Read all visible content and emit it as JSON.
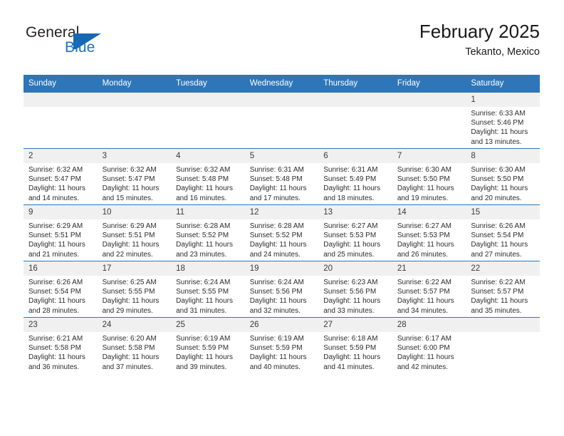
{
  "brand": {
    "name_part1": "General",
    "name_part2": "Blue",
    "logo_icon": "triangle-logo-icon"
  },
  "header": {
    "title": "February 2025",
    "subtitle": "Tekanto, Mexico"
  },
  "calendar": {
    "weekday_headers": [
      "Sunday",
      "Monday",
      "Tuesday",
      "Wednesday",
      "Thursday",
      "Friday",
      "Saturday"
    ],
    "accent_color": "#2e76b8",
    "daynum_bg": "#f0f0f0",
    "weeks": [
      [
        {
          "blank": true
        },
        {
          "blank": true
        },
        {
          "blank": true
        },
        {
          "blank": true
        },
        {
          "blank": true
        },
        {
          "blank": true
        },
        {
          "day": "1",
          "sunrise": "Sunrise: 6:33 AM",
          "sunset": "Sunset: 5:46 PM",
          "daylight_line1": "Daylight: 11 hours",
          "daylight_line2": "and 13 minutes."
        }
      ],
      [
        {
          "day": "2",
          "sunrise": "Sunrise: 6:32 AM",
          "sunset": "Sunset: 5:47 PM",
          "daylight_line1": "Daylight: 11 hours",
          "daylight_line2": "and 14 minutes."
        },
        {
          "day": "3",
          "sunrise": "Sunrise: 6:32 AM",
          "sunset": "Sunset: 5:47 PM",
          "daylight_line1": "Daylight: 11 hours",
          "daylight_line2": "and 15 minutes."
        },
        {
          "day": "4",
          "sunrise": "Sunrise: 6:32 AM",
          "sunset": "Sunset: 5:48 PM",
          "daylight_line1": "Daylight: 11 hours",
          "daylight_line2": "and 16 minutes."
        },
        {
          "day": "5",
          "sunrise": "Sunrise: 6:31 AM",
          "sunset": "Sunset: 5:48 PM",
          "daylight_line1": "Daylight: 11 hours",
          "daylight_line2": "and 17 minutes."
        },
        {
          "day": "6",
          "sunrise": "Sunrise: 6:31 AM",
          "sunset": "Sunset: 5:49 PM",
          "daylight_line1": "Daylight: 11 hours",
          "daylight_line2": "and 18 minutes."
        },
        {
          "day": "7",
          "sunrise": "Sunrise: 6:30 AM",
          "sunset": "Sunset: 5:50 PM",
          "daylight_line1": "Daylight: 11 hours",
          "daylight_line2": "and 19 minutes."
        },
        {
          "day": "8",
          "sunrise": "Sunrise: 6:30 AM",
          "sunset": "Sunset: 5:50 PM",
          "daylight_line1": "Daylight: 11 hours",
          "daylight_line2": "and 20 minutes."
        }
      ],
      [
        {
          "day": "9",
          "sunrise": "Sunrise: 6:29 AM",
          "sunset": "Sunset: 5:51 PM",
          "daylight_line1": "Daylight: 11 hours",
          "daylight_line2": "and 21 minutes."
        },
        {
          "day": "10",
          "sunrise": "Sunrise: 6:29 AM",
          "sunset": "Sunset: 5:51 PM",
          "daylight_line1": "Daylight: 11 hours",
          "daylight_line2": "and 22 minutes."
        },
        {
          "day": "11",
          "sunrise": "Sunrise: 6:28 AM",
          "sunset": "Sunset: 5:52 PM",
          "daylight_line1": "Daylight: 11 hours",
          "daylight_line2": "and 23 minutes."
        },
        {
          "day": "12",
          "sunrise": "Sunrise: 6:28 AM",
          "sunset": "Sunset: 5:52 PM",
          "daylight_line1": "Daylight: 11 hours",
          "daylight_line2": "and 24 minutes."
        },
        {
          "day": "13",
          "sunrise": "Sunrise: 6:27 AM",
          "sunset": "Sunset: 5:53 PM",
          "daylight_line1": "Daylight: 11 hours",
          "daylight_line2": "and 25 minutes."
        },
        {
          "day": "14",
          "sunrise": "Sunrise: 6:27 AM",
          "sunset": "Sunset: 5:53 PM",
          "daylight_line1": "Daylight: 11 hours",
          "daylight_line2": "and 26 minutes."
        },
        {
          "day": "15",
          "sunrise": "Sunrise: 6:26 AM",
          "sunset": "Sunset: 5:54 PM",
          "daylight_line1": "Daylight: 11 hours",
          "daylight_line2": "and 27 minutes."
        }
      ],
      [
        {
          "day": "16",
          "sunrise": "Sunrise: 6:26 AM",
          "sunset": "Sunset: 5:54 PM",
          "daylight_line1": "Daylight: 11 hours",
          "daylight_line2": "and 28 minutes."
        },
        {
          "day": "17",
          "sunrise": "Sunrise: 6:25 AM",
          "sunset": "Sunset: 5:55 PM",
          "daylight_line1": "Daylight: 11 hours",
          "daylight_line2": "and 29 minutes."
        },
        {
          "day": "18",
          "sunrise": "Sunrise: 6:24 AM",
          "sunset": "Sunset: 5:55 PM",
          "daylight_line1": "Daylight: 11 hours",
          "daylight_line2": "and 31 minutes."
        },
        {
          "day": "19",
          "sunrise": "Sunrise: 6:24 AM",
          "sunset": "Sunset: 5:56 PM",
          "daylight_line1": "Daylight: 11 hours",
          "daylight_line2": "and 32 minutes."
        },
        {
          "day": "20",
          "sunrise": "Sunrise: 6:23 AM",
          "sunset": "Sunset: 5:56 PM",
          "daylight_line1": "Daylight: 11 hours",
          "daylight_line2": "and 33 minutes."
        },
        {
          "day": "21",
          "sunrise": "Sunrise: 6:22 AM",
          "sunset": "Sunset: 5:57 PM",
          "daylight_line1": "Daylight: 11 hours",
          "daylight_line2": "and 34 minutes."
        },
        {
          "day": "22",
          "sunrise": "Sunrise: 6:22 AM",
          "sunset": "Sunset: 5:57 PM",
          "daylight_line1": "Daylight: 11 hours",
          "daylight_line2": "and 35 minutes."
        }
      ],
      [
        {
          "day": "23",
          "sunrise": "Sunrise: 6:21 AM",
          "sunset": "Sunset: 5:58 PM",
          "daylight_line1": "Daylight: 11 hours",
          "daylight_line2": "and 36 minutes."
        },
        {
          "day": "24",
          "sunrise": "Sunrise: 6:20 AM",
          "sunset": "Sunset: 5:58 PM",
          "daylight_line1": "Daylight: 11 hours",
          "daylight_line2": "and 37 minutes."
        },
        {
          "day": "25",
          "sunrise": "Sunrise: 6:19 AM",
          "sunset": "Sunset: 5:59 PM",
          "daylight_line1": "Daylight: 11 hours",
          "daylight_line2": "and 39 minutes."
        },
        {
          "day": "26",
          "sunrise": "Sunrise: 6:19 AM",
          "sunset": "Sunset: 5:59 PM",
          "daylight_line1": "Daylight: 11 hours",
          "daylight_line2": "and 40 minutes."
        },
        {
          "day": "27",
          "sunrise": "Sunrise: 6:18 AM",
          "sunset": "Sunset: 5:59 PM",
          "daylight_line1": "Daylight: 11 hours",
          "daylight_line2": "and 41 minutes."
        },
        {
          "day": "28",
          "sunrise": "Sunrise: 6:17 AM",
          "sunset": "Sunset: 6:00 PM",
          "daylight_line1": "Daylight: 11 hours",
          "daylight_line2": "and 42 minutes."
        },
        {
          "blank": true
        }
      ]
    ]
  }
}
